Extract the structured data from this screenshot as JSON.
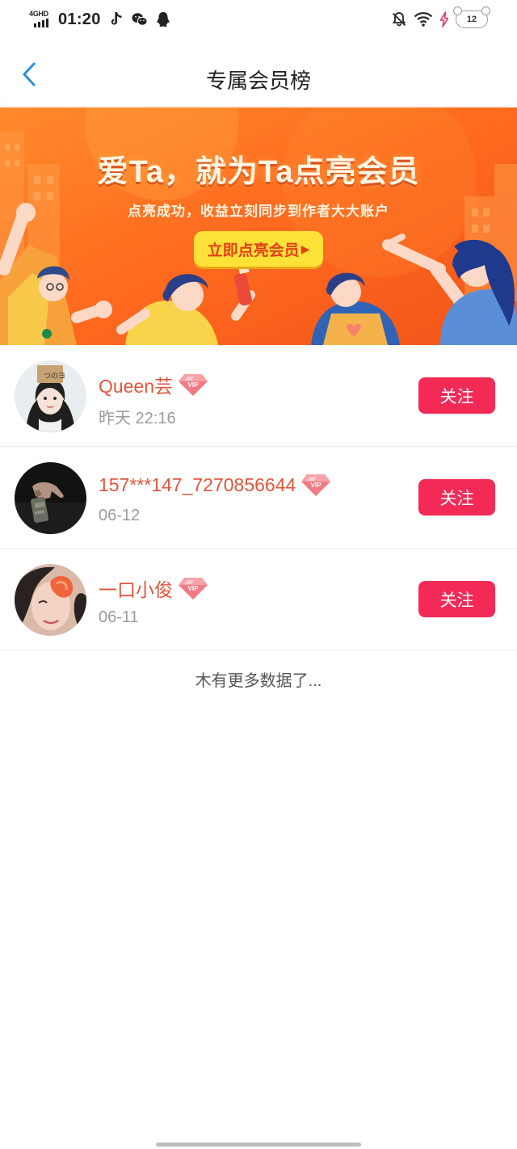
{
  "status_bar": {
    "network": "4GHD",
    "time": "01:20",
    "battery": "12",
    "app_icons": [
      "tiktok-icon",
      "wechat-icon",
      "qq-icon"
    ],
    "system_icons": [
      "mute-icon",
      "wifi-icon",
      "charging-icon",
      "battery-icon"
    ]
  },
  "nav": {
    "title": "专属会员榜",
    "back_icon": "back-arrow-icon"
  },
  "banner": {
    "headline": "爱Ta，就为Ta点亮会员",
    "subtitle": "点亮成功，收益立刻同步到作者大大账户",
    "cta_label": "立即点亮会员",
    "cta_icon": "play-arrow-icon",
    "colors": {
      "background": "#ff6b23",
      "cta": "#ffe237",
      "cta_text": "#e53e1a"
    }
  },
  "members": [
    {
      "name": "Queen芸",
      "badge": "VIP",
      "date": "昨天 22:16",
      "follow_label": "关注"
    },
    {
      "name": "157***147_7270856644",
      "badge": "VIP",
      "date": "06-12",
      "follow_label": "关注"
    },
    {
      "name": "一口小俊",
      "badge": "VIP",
      "date": "06-11",
      "follow_label": "关注"
    }
  ],
  "footer_text": "木有更多数据了...",
  "colors": {
    "name": "#e0553a",
    "follow_button": "#f42a56",
    "accent": "#2a8fe0"
  }
}
